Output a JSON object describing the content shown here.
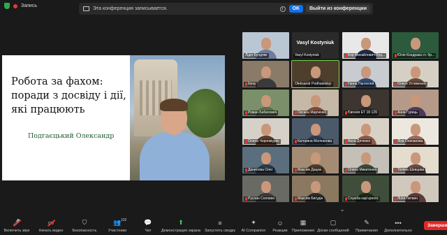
{
  "top": {
    "rec_label": "Запись"
  },
  "banner": {
    "text": "Эта конференция записывается.",
    "info": "i",
    "ok_label": "OK",
    "leave_label": "Выйти из конференции"
  },
  "slide": {
    "title": "Робота за фахом: поради з досвіду і дії, які працюють",
    "author": "Подгаєцький Олександр"
  },
  "gallery": {
    "tiles": [
      {
        "name": "Лідія Булдчик",
        "bg": "#b9c7d4",
        "shirt": "#6e7c9a",
        "muted": false
      },
      {
        "name": "Vasyl Kostyniuk",
        "bg": "#2a2a2a",
        "shirt": "#2a2a2a",
        "muted": false,
        "nameplate": true
      },
      {
        "name": "Ігор Михайлович Луц...",
        "bg": "#e8e8e8",
        "shirt": "#1f2a44",
        "muted": true
      },
      {
        "name": "Юлія Кондрака ст. бр...",
        "bg": "#2b5a3c",
        "shirt": "#315a44",
        "muted": true
      },
      {
        "name": "Ilona",
        "bg": "#8a7a68",
        "shirt": "#3a3a3a",
        "muted": true
      },
      {
        "name": "Oleksandr Podhaietskyi",
        "bg": "#4e3e2c",
        "shirt": "#2c2c2c",
        "muted": false,
        "active": true
      },
      {
        "name": "Ганна Пантелей",
        "bg": "#c8ccd0",
        "shirt": "#2d4d7a",
        "muted": true
      },
      {
        "name": "Олеся Устименко",
        "bg": "#d6d0c4",
        "shirt": "#6b4a3a",
        "muted": true
      },
      {
        "name": "Роман Бабисевич",
        "bg": "#7a8f6a",
        "shirt": "#5a6b4a",
        "muted": true
      },
      {
        "name": "Оксана Марченко",
        "bg": "#c5b8a6",
        "shirt": "#7a4a3a",
        "muted": true
      },
      {
        "name": "Євгенія ЕТ 18 129",
        "bg": "#3c3530",
        "shirt": "#2a2a2a",
        "muted": true
      },
      {
        "name": "Анна Гурець",
        "bg": "#b59a8a",
        "shirt": "#4a3a5a",
        "muted": true
      },
      {
        "name": "Олена Чорномурко",
        "bg": "#d5d0c8",
        "shirt": "#5a3a2a",
        "muted": true
      },
      {
        "name": "Катерина Молчанова",
        "bg": "#4a5a6a",
        "shirt": "#2a3a4a",
        "muted": true
      },
      {
        "name": "Анна Дяченко",
        "bg": "#d8d2c6",
        "shirt": "#8a5a4a",
        "muted": true
      },
      {
        "name": "Ліза Опачанова",
        "bg": "#ece8e0",
        "shirt": "#9a6a5a",
        "muted": true
      },
      {
        "name": "Данилова Олег",
        "bg": "#5a6e7e",
        "shirt": "#2a3a4a",
        "muted": true
      },
      {
        "name": "Максим Дацюк",
        "bg": "#a48c74",
        "shirt": "#4a3a2a",
        "muted": true
      },
      {
        "name": "Олена Микитенко",
        "bg": "#c4c0b8",
        "shirt": "#3a4a3a",
        "muted": true
      },
      {
        "name": "Тетяна Шевцова",
        "bg": "#e4dccc",
        "shirt": "#6a4a4a",
        "muted": true
      },
      {
        "name": "Руслан Соловян",
        "bg": "#6a6a64",
        "shirt": "#3a3a3a",
        "muted": true
      },
      {
        "name": "Максим Бигудін",
        "bg": "#8a7860",
        "shirt": "#2a2a2a",
        "muted": true
      },
      {
        "name": "Служба кар'єрного",
        "bg": "#3f4e3a",
        "shirt": "#1a2a1a",
        "muted": true
      },
      {
        "name": "Лілія Литвин",
        "bg": "#d0c8bc",
        "shirt": "#5a3a3a",
        "muted": true
      }
    ]
  },
  "toolbar": {
    "items": [
      {
        "label": "Включить звук",
        "icon": "🎤",
        "strike": true
      },
      {
        "label": "Начать видео",
        "icon": "▭",
        "strike": true
      },
      {
        "label": "Безопасность",
        "icon": "⛉",
        "strike": false
      },
      {
        "label": "Участники",
        "icon": "👥",
        "strike": false,
        "count": "102"
      },
      {
        "label": "Чат",
        "icon": "💬",
        "strike": false
      },
      {
        "label": "Демонстрация экрана",
        "icon": "⬆",
        "strike": false,
        "green": true
      },
      {
        "label": "Запустить сводку",
        "icon": "≡",
        "strike": false
      },
      {
        "label": "AI Companion",
        "icon": "✦",
        "strike": false
      },
      {
        "label": "Реакции",
        "icon": "☺",
        "strike": false
      },
      {
        "label": "Приложения",
        "icon": "▦",
        "strike": false
      },
      {
        "label": "Доски сообщений",
        "icon": "▢",
        "strike": false
      },
      {
        "label": "Примечания",
        "icon": "✎",
        "strike": false
      },
      {
        "label": "Дополнительно",
        "icon": "•••",
        "strike": false
      }
    ],
    "end_label": "Заверши"
  },
  "colors": {
    "accent": "#0e71eb",
    "end": "#e02828",
    "share_green": "#3ecc5c"
  }
}
